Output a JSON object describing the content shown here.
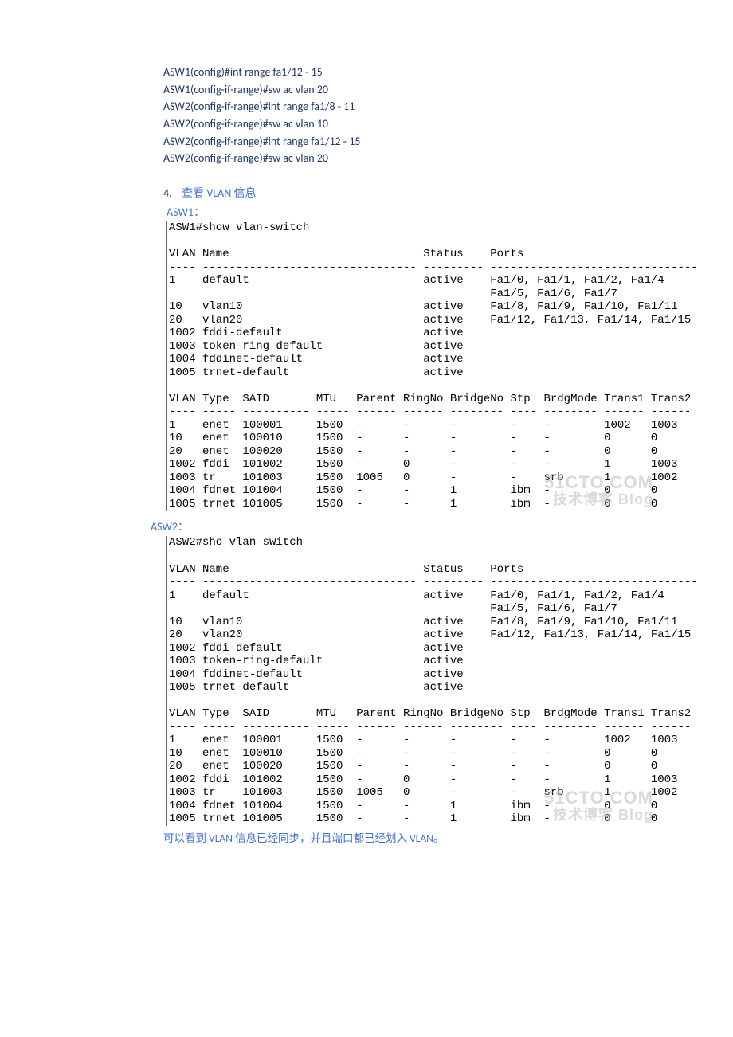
{
  "config_lines": [
    "ASW1(config)#int range fa1/12 - 15",
    " ASW1(config-if-range)#sw ac vlan 20",
    "ASW2(config-if-range)#int range fa1/8 - 11",
    "ASW2(config-if-range)#sw ac vlan 10",
    "ASW2(config-if-range)#int range fa1/12 - 15",
    " ASW2(config-if-range)#sw ac vlan 20"
  ],
  "step": {
    "num": "4.",
    "zh_pre": "查看 ",
    "vlan": "VLAN",
    "zh_post": " 信息"
  },
  "asw1_label": "ASW1：",
  "asw2_label": "ASW2：",
  "asw1_cmd": "ASW1#show vlan-switch",
  "asw2_cmd": "ASW2#sho vlan-switch",
  "table1_header": "VLAN Name                             Status    Ports",
  "table1_divider": "---- -------------------------------- --------- -------------------------------",
  "table1_rows": [
    "1    default                          active    Fa1/0, Fa1/1, Fa1/2, Fa1/4",
    "                                                Fa1/5, Fa1/6, Fa1/7",
    "10   vlan10                           active    Fa1/8, Fa1/9, Fa1/10, Fa1/11",
    "20   vlan20                           active    Fa1/12, Fa1/13, Fa1/14, Fa1/15",
    "1002 fddi-default                     active    ",
    "1003 token-ring-default               active    ",
    "1004 fddinet-default                  active    ",
    "1005 trnet-default                    active    "
  ],
  "table2_header": "VLAN Type  SAID       MTU   Parent RingNo BridgeNo Stp  BrdgMode Trans1 Trans2",
  "table2_divider": "---- ----- ---------- ----- ------ ------ -------- ---- -------- ------ ------",
  "table2_rows": [
    "1    enet  100001     1500  -      -      -        -    -        1002   1003",
    "10   enet  100010     1500  -      -      -        -    -        0      0",
    "20   enet  100020     1500  -      -      -        -    -        0      0",
    "1002 fddi  101002     1500  -      0      -        -    -        1      1003",
    "1003 tr    101003     1500  1005   0      -        -    srb      1      1002",
    "1004 fdnet 101004     1500  -      -      1        ibm  -        0      0",
    "1005 trnet 101005     1500  -      -      1        ibm  -        0      0"
  ],
  "watermark1_a": "51CTO.COM",
  "watermark1_b": "技术博客   Blog",
  "watermark2_a": "51CTO.COM",
  "watermark2_b": "技术博客   Blog",
  "footer_cn": "可以看到 VLAN 信息已经同步，并且端口都已经划入 VLAN。"
}
